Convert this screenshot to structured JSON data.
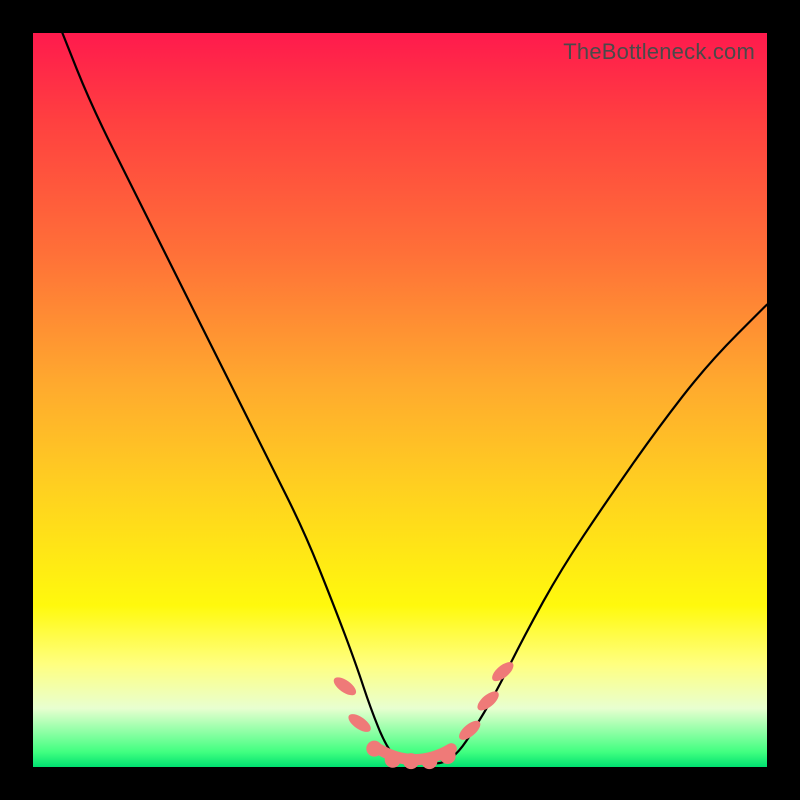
{
  "attribution": "TheBottleneck.com",
  "colors": {
    "frame": "#000000",
    "curve": "#000000",
    "marker": "#ef7a78"
  },
  "chart_data": {
    "type": "line",
    "title": "",
    "xlabel": "",
    "ylabel": "",
    "xlim": [
      0,
      100
    ],
    "ylim": [
      0,
      100
    ],
    "gradient_stops": [
      {
        "pos": 0,
        "color": "#ff1a4d"
      },
      {
        "pos": 12,
        "color": "#ff4040"
      },
      {
        "pos": 30,
        "color": "#ff7038"
      },
      {
        "pos": 48,
        "color": "#ffaa2e"
      },
      {
        "pos": 62,
        "color": "#ffd020"
      },
      {
        "pos": 78,
        "color": "#fff90d"
      },
      {
        "pos": 86,
        "color": "#ffff80"
      },
      {
        "pos": 92,
        "color": "#e8ffd0"
      },
      {
        "pos": 98,
        "color": "#40ff80"
      },
      {
        "pos": 100,
        "color": "#00e070"
      }
    ],
    "series": [
      {
        "name": "bottleneck-curve",
        "x": [
          4,
          8,
          14,
          20,
          26,
          32,
          37,
          41,
          44,
          46,
          48,
          50,
          52,
          54,
          56,
          58,
          60,
          63,
          67,
          72,
          78,
          85,
          92,
          100
        ],
        "y": [
          100,
          90,
          78,
          66,
          54,
          42,
          32,
          22,
          14,
          8,
          3,
          0.5,
          0.5,
          0.5,
          0.5,
          2,
          5,
          10,
          18,
          27,
          36,
          46,
          55,
          63
        ]
      }
    ],
    "markers": [
      {
        "x": 42.5,
        "y": 11,
        "shape": "oval",
        "tilt": -55
      },
      {
        "x": 44.5,
        "y": 6,
        "shape": "oval",
        "tilt": -55
      },
      {
        "x": 46.5,
        "y": 2.5,
        "shape": "round"
      },
      {
        "x": 49,
        "y": 1,
        "shape": "round"
      },
      {
        "x": 51.5,
        "y": 0.8,
        "shape": "round"
      },
      {
        "x": 54,
        "y": 0.8,
        "shape": "round"
      },
      {
        "x": 56.5,
        "y": 1.5,
        "shape": "round"
      },
      {
        "x": 59.5,
        "y": 5,
        "shape": "oval",
        "tilt": 50
      },
      {
        "x": 62,
        "y": 9,
        "shape": "oval",
        "tilt": 50
      },
      {
        "x": 64,
        "y": 13,
        "shape": "oval",
        "tilt": 50
      }
    ],
    "valley_band": {
      "x_start": 47,
      "x_end": 57,
      "y": 1
    }
  }
}
